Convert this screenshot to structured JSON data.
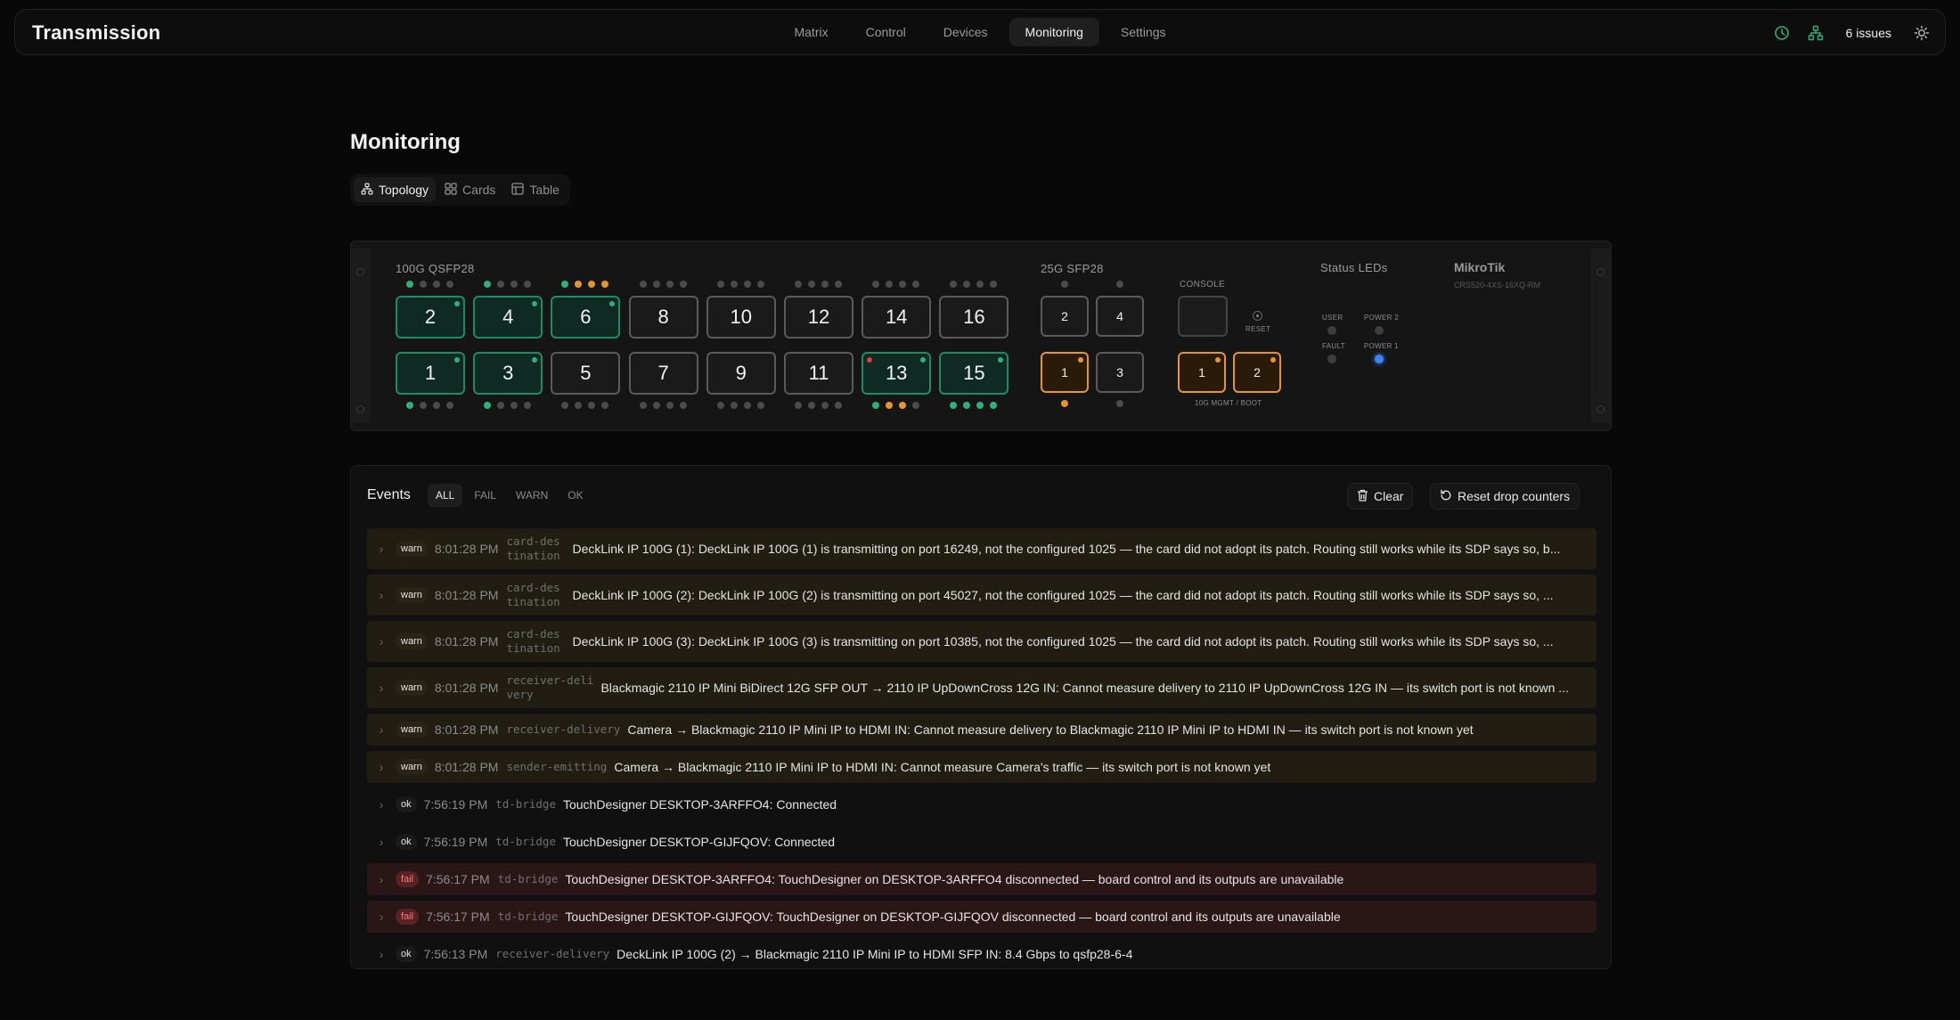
{
  "app": {
    "title": "Transmission"
  },
  "nav": {
    "items": [
      {
        "label": "Matrix",
        "active": false
      },
      {
        "label": "Control",
        "active": false
      },
      {
        "label": "Devices",
        "active": false
      },
      {
        "label": "Monitoring",
        "active": true
      },
      {
        "label": "Settings",
        "active": false
      }
    ]
  },
  "top_right": {
    "issues_label": "6 issues",
    "icons": [
      "history-icon",
      "topology-icon",
      "theme-toggle-icon"
    ]
  },
  "page": {
    "title": "Monitoring"
  },
  "view_tabs": [
    {
      "label": "Topology",
      "icon": "topology-icon",
      "active": true
    },
    {
      "label": "Cards",
      "icon": "grid-icon",
      "active": false
    },
    {
      "label": "Table",
      "icon": "table-icon",
      "active": false
    }
  ],
  "switch": {
    "qsfp_label": "100G QSFP28",
    "sfp_label": "25G SFP28",
    "console_label": "CONSOLE",
    "reset_label": "RESET",
    "mgmt_label": "10G MGMT / BOOT",
    "status_leds_label": "Status LEDs",
    "led_labels": {
      "user": "USER",
      "power2": "POWER 2",
      "fault": "FAULT",
      "power1": "POWER 1"
    },
    "brand": "MikroTik",
    "model": "CRS520-4XS-16XQ-RM",
    "qsfp_top": [
      {
        "num": "2",
        "state": "green",
        "dots": [
          "g",
          "n",
          "n",
          "n"
        ]
      },
      {
        "num": "4",
        "state": "green",
        "dots": [
          "g",
          "n",
          "n",
          "n"
        ]
      },
      {
        "num": "6",
        "state": "green",
        "dots": [
          "g",
          "o",
          "o",
          "o"
        ]
      },
      {
        "num": "8",
        "state": "off",
        "dots": [
          "n",
          "n",
          "n",
          "n"
        ]
      },
      {
        "num": "10",
        "state": "off",
        "dots": [
          "n",
          "n",
          "n",
          "n"
        ]
      },
      {
        "num": "12",
        "state": "off",
        "dots": [
          "n",
          "n",
          "n",
          "n"
        ]
      },
      {
        "num": "14",
        "state": "off",
        "dots": [
          "n",
          "n",
          "n",
          "n"
        ]
      },
      {
        "num": "16",
        "state": "off",
        "dots": [
          "n",
          "n",
          "n",
          "n"
        ]
      }
    ],
    "qsfp_bottom": [
      {
        "num": "1",
        "state": "green",
        "dots": [
          "g",
          "n",
          "n",
          "n"
        ]
      },
      {
        "num": "3",
        "state": "green",
        "dots": [
          "g",
          "n",
          "n",
          "n"
        ]
      },
      {
        "num": "5",
        "state": "off",
        "dots": [
          "n",
          "n",
          "n",
          "n"
        ]
      },
      {
        "num": "7",
        "state": "off",
        "dots": [
          "n",
          "n",
          "n",
          "n"
        ]
      },
      {
        "num": "9",
        "state": "off",
        "dots": [
          "n",
          "n",
          "n",
          "n"
        ]
      },
      {
        "num": "11",
        "state": "off",
        "dots": [
          "n",
          "n",
          "n",
          "n"
        ]
      },
      {
        "num": "13",
        "state": "green",
        "dots": [
          "g",
          "o",
          "o",
          "n"
        ]
      },
      {
        "num": "15",
        "state": "green",
        "dots": [
          "g",
          "g",
          "g",
          "g"
        ]
      }
    ],
    "sfp_top": [
      {
        "num": "2",
        "state": "off"
      },
      {
        "num": "4",
        "state": "off"
      }
    ],
    "sfp_bottom": [
      {
        "num": "1",
        "state": "orange"
      },
      {
        "num": "3",
        "state": "off"
      }
    ],
    "mgmt_ports": [
      {
        "num": "1",
        "state": "orange"
      },
      {
        "num": "2",
        "state": "orange"
      }
    ]
  },
  "events": {
    "title": "Events",
    "filters": [
      {
        "label": "ALL",
        "active": true
      },
      {
        "label": "FAIL",
        "active": false
      },
      {
        "label": "WARN",
        "active": false
      },
      {
        "label": "OK",
        "active": false
      }
    ],
    "clear_label": "Clear",
    "reset_label": "Reset drop counters",
    "rows": [
      {
        "level": "warn",
        "time": "8:01:28 PM",
        "source": "card-destination",
        "message": "DeckLink IP 100G (1): DeckLink IP 100G (1) is transmitting on port 16249, not the configured 1025 — the card did not adopt its patch. Routing still works while its SDP says so, b..."
      },
      {
        "level": "warn",
        "time": "8:01:28 PM",
        "source": "card-destination",
        "message": "DeckLink IP 100G (2): DeckLink IP 100G (2) is transmitting on port 45027, not the configured 1025 — the card did not adopt its patch. Routing still works while its SDP says so, ..."
      },
      {
        "level": "warn",
        "time": "8:01:28 PM",
        "source": "card-destination",
        "message": "DeckLink IP 100G (3): DeckLink IP 100G (3) is transmitting on port 10385, not the configured 1025 — the card did not adopt its patch. Routing still works while its SDP says so, ..."
      },
      {
        "level": "warn",
        "time": "8:01:28 PM",
        "source": "receiver-delivery",
        "message": "Blackmagic 2110 IP Mini BiDirect 12G SFP OUT → 2110 IP UpDownCross 12G IN: Cannot measure delivery to 2110 IP UpDownCross 12G IN — its switch port is not known ..."
      },
      {
        "level": "warn",
        "time": "8:01:28 PM",
        "source": "receiver-delivery",
        "message": "Camera → Blackmagic 2110 IP Mini IP to HDMI IN: Cannot measure delivery to Blackmagic 2110 IP Mini IP to HDMI IN — its switch port is not known yet"
      },
      {
        "level": "warn",
        "time": "8:01:28 PM",
        "source": "sender-emitting",
        "message": "Camera → Blackmagic 2110 IP Mini IP to HDMI IN: Cannot measure Camera's traffic — its switch port is not known yet"
      },
      {
        "level": "ok",
        "time": "7:56:19 PM",
        "source": "td-bridge",
        "message": "TouchDesigner DESKTOP-3ARFFO4: Connected"
      },
      {
        "level": "ok",
        "time": "7:56:19 PM",
        "source": "td-bridge",
        "message": "TouchDesigner DESKTOP-GIJFQOV: Connected"
      },
      {
        "level": "fail",
        "time": "7:56:17 PM",
        "source": "td-bridge",
        "message": "TouchDesigner DESKTOP-3ARFFO4: TouchDesigner on DESKTOP-3ARFFO4 disconnected — board control and its outputs are unavailable"
      },
      {
        "level": "fail",
        "time": "7:56:17 PM",
        "source": "td-bridge",
        "message": "TouchDesigner DESKTOP-GIJFQOV: TouchDesigner on DESKTOP-GIJFQOV disconnected — board control and its outputs are unavailable"
      },
      {
        "level": "ok",
        "time": "7:56:13 PM",
        "source": "receiver-delivery",
        "message": "DeckLink IP 100G (2) → Blackmagic 2110 IP Mini IP to HDMI SFP IN: 8.4 Gbps to qsfp28-6-4"
      }
    ]
  },
  "colors": {
    "green": "#2db07d",
    "orange": "#e4952e",
    "red": "#d94040",
    "warn_row": "#211d13",
    "fail_row": "#2b1617"
  }
}
